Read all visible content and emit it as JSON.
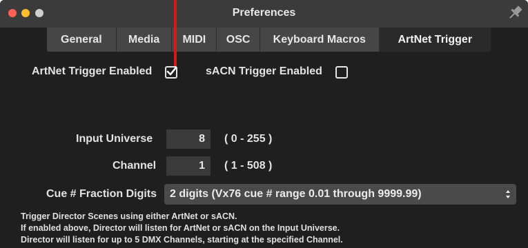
{
  "window": {
    "title": "Preferences"
  },
  "tabs": [
    {
      "label": "General",
      "active": false
    },
    {
      "label": "Media",
      "active": false
    },
    {
      "label": "MIDI",
      "active": false
    },
    {
      "label": "OSC",
      "active": false
    },
    {
      "label": "Keyboard Macros",
      "active": false
    },
    {
      "label": "ArtNet Trigger",
      "active": true
    }
  ],
  "triggers": {
    "artnet": {
      "label": "ArtNet Trigger Enabled",
      "checked": true
    },
    "sacn": {
      "label": "sACN Trigger Enabled",
      "checked": false
    }
  },
  "input_universe": {
    "label": "Input Universe",
    "value": "8",
    "range": "( 0 - 255 )"
  },
  "channel": {
    "label": "Channel",
    "value": "1",
    "range": "( 1 - 508 )"
  },
  "cue_fraction": {
    "label": "Cue # Fraction Digits",
    "selected": "2 digits (Vx76 cue # range 0.01 through 9999.99)"
  },
  "help": {
    "line1": "Trigger Director Scenes using either ArtNet or sACN.",
    "line2": "If enabled above, Director will listen for ArtNet or sACN on the Input Universe.",
    "line3": "Director will listen for up to 5 DMX Channels, starting at the specified Channel."
  },
  "colors": {
    "panel": "#1f1f1f",
    "titlebar": "#3b3b3b",
    "callout": "#d31b1b",
    "close": "#fe5f57",
    "minimize": "#febc2e"
  }
}
